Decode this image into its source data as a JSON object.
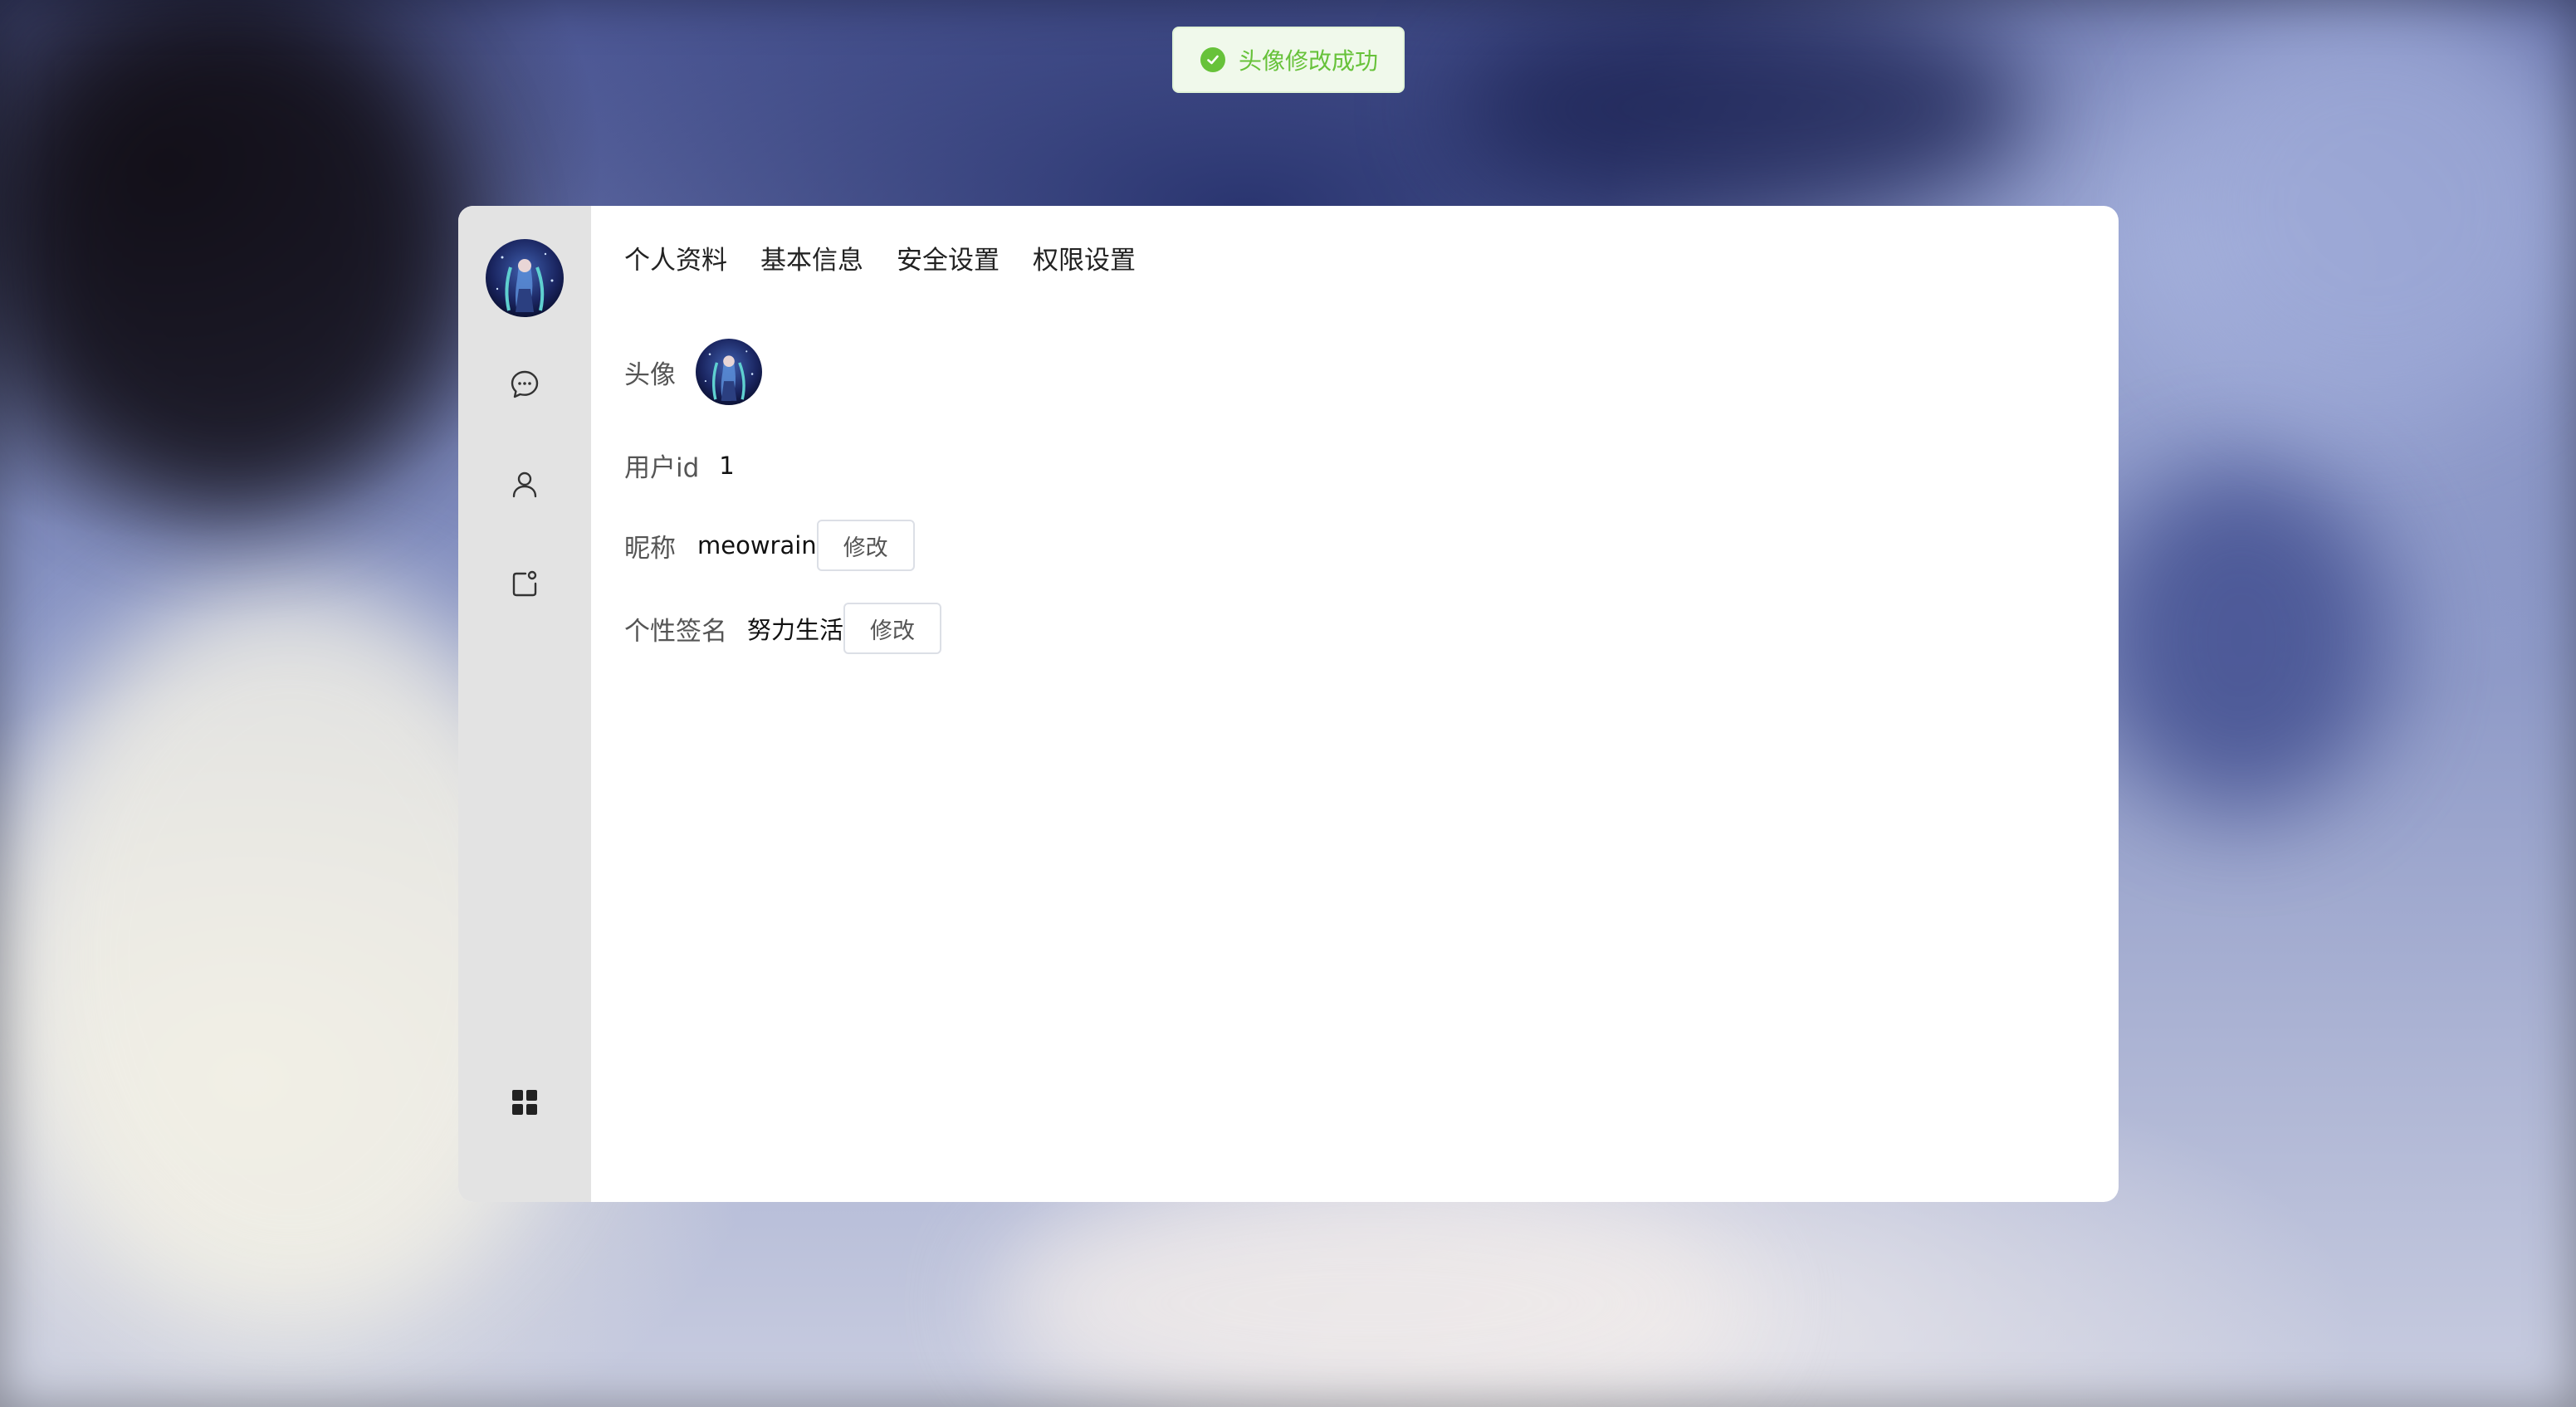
{
  "toast": {
    "message": "头像修改成功",
    "icon": "check-circle-icon",
    "color": "#67c23a"
  },
  "sidebar": {
    "items": [
      {
        "name": "chat",
        "icon": "chat-bubble-icon"
      },
      {
        "name": "user",
        "icon": "user-icon"
      },
      {
        "name": "share",
        "icon": "share-icon"
      }
    ],
    "bottom_icon": "grid-apps-icon"
  },
  "tabs": [
    "个人资料",
    "基本信息",
    "安全设置",
    "权限设置"
  ],
  "profile": {
    "avatar_label": "头像",
    "user_id_label": "用户id",
    "user_id_value": "1",
    "nickname_label": "昵称",
    "nickname_value": "meowrain",
    "nickname_edit": "修改",
    "signature_label": "个性签名",
    "signature_value": "努力生活",
    "signature_edit": "修改"
  }
}
